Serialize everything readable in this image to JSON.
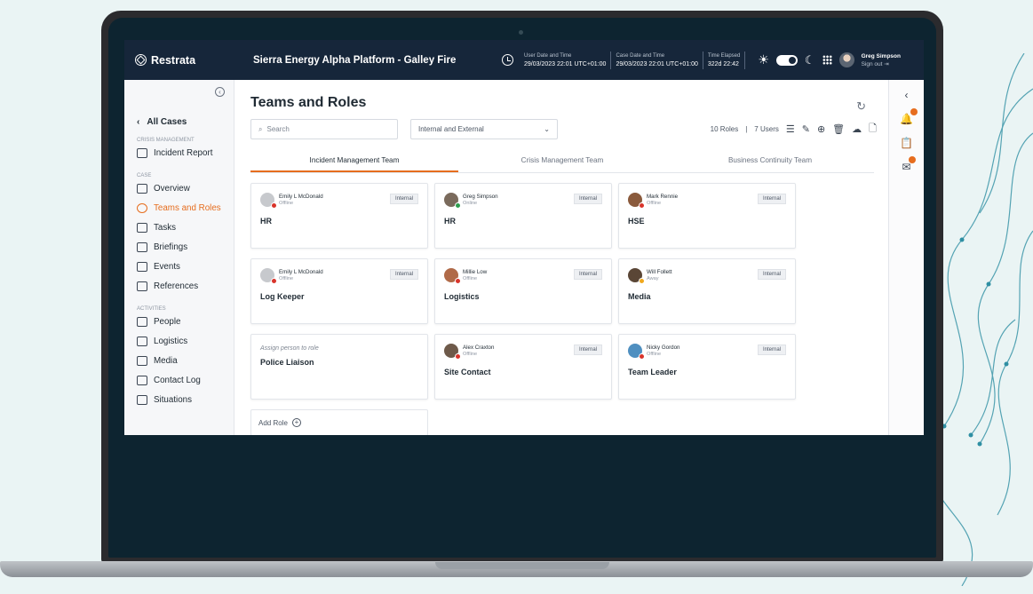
{
  "app": {
    "brand": "Restrata",
    "case_title": "Sierra Energy Alpha Platform - Galley Fire"
  },
  "times": [
    {
      "label": "User Date and Time",
      "value": "29/03/2023 22:01 UTC+01:00"
    },
    {
      "label": "Case Date and Time",
      "value": "29/03/2023 22:01 UTC+01:00"
    },
    {
      "label": "Time Elapsed",
      "value": "322d 22:42"
    }
  ],
  "user": {
    "name": "Greg Simpson",
    "sign_out": "Sign out"
  },
  "sidebar": {
    "all_cases": "All Cases",
    "sections": {
      "crisis_management": "Crisis Management",
      "case": "Case",
      "activities": "Activities"
    },
    "crisis_items": [
      {
        "label": "Incident Report",
        "icon": "folder-icon"
      }
    ],
    "case_items": [
      {
        "label": "Overview",
        "icon": "chart-icon"
      },
      {
        "label": "Teams and Roles",
        "icon": "team-icon",
        "active": true
      },
      {
        "label": "Tasks",
        "icon": "tasks-icon"
      },
      {
        "label": "Briefings",
        "icon": "briefings-icon"
      },
      {
        "label": "Events",
        "icon": "events-icon"
      },
      {
        "label": "References",
        "icon": "references-icon"
      }
    ],
    "activity_items": [
      {
        "label": "People",
        "icon": "people-icon"
      },
      {
        "label": "Logistics",
        "icon": "logistics-icon"
      },
      {
        "label": "Media",
        "icon": "media-icon"
      },
      {
        "label": "Contact Log",
        "icon": "phone-icon"
      },
      {
        "label": "Situations",
        "icon": "situations-icon"
      }
    ]
  },
  "main": {
    "title": "Teams and Roles",
    "search_placeholder": "Search",
    "filter_value": "Internal and External",
    "roles_count": "10 Roles",
    "users_count": "7 Users",
    "tabs": [
      {
        "label": "Incident Management Team",
        "active": true
      },
      {
        "label": "Crisis Management Team"
      },
      {
        "label": "Business Continuity Team"
      }
    ],
    "cards": [
      {
        "person": "Emily L McDonald",
        "status": "Offline",
        "badge": "Internal",
        "role": "HR"
      },
      {
        "person": "Greg Simpson",
        "status": "Online",
        "badge": "Internal",
        "role": "HR"
      },
      {
        "person": "Mark Rennie",
        "status": "Offline",
        "badge": "Internal",
        "role": "HSE"
      },
      {
        "person": "Emily L McDonald",
        "status": "Offline",
        "badge": "Internal",
        "role": "Log Keeper"
      },
      {
        "person": "Millie Low",
        "status": "Offline",
        "badge": "Internal",
        "role": "Logistics"
      },
      {
        "person": "Will Follett",
        "status": "Away",
        "badge": "Internal",
        "role": "Media"
      },
      {
        "assign": "Assign person to role",
        "role": "Police Liaison"
      },
      {
        "person": "Alex Craxton",
        "status": "Offline",
        "badge": "Internal",
        "role": "Site Contact"
      },
      {
        "person": "Nicky Gordon",
        "status": "Offline",
        "badge": "Internal",
        "role": "Team Leader"
      }
    ],
    "add_role": "Add Role"
  },
  "colors": {
    "topbar": "#16263a",
    "accent": "#e66d1e",
    "online": "#2e9e4f",
    "offline": "#d9342b",
    "away": "#f0a81c"
  }
}
